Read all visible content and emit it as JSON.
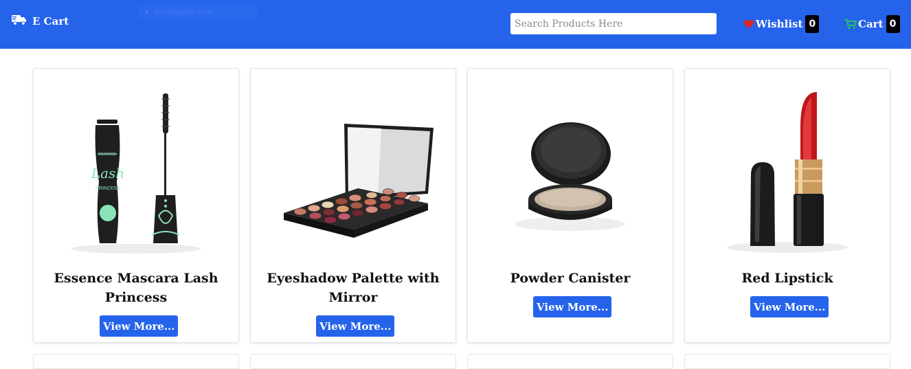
{
  "navbar": {
    "brand": "E Cart",
    "brand_icon": "truck-icon",
    "search_placeholder": "Search Products Here",
    "wishlist_label": "Wishlist",
    "wishlist_count": "0",
    "cart_label": "Cart",
    "cart_count": "0",
    "colors": {
      "bar": "#2563eb",
      "heart": "#dc2626",
      "cart_icon": "#22c55e"
    }
  },
  "snip_overlay": {
    "label": "Rectangular Snip"
  },
  "products": [
    {
      "title": "Essence Mascara Lash Princess",
      "button": "View More...",
      "image": "mascara-image"
    },
    {
      "title": "Eyeshadow Palette with Mirror",
      "button": "View More...",
      "image": "eyeshadow-palette-image"
    },
    {
      "title": "Powder Canister",
      "button": "View More...",
      "image": "powder-canister-image"
    },
    {
      "title": "Red Lipstick",
      "button": "View More...",
      "image": "red-lipstick-image"
    }
  ]
}
